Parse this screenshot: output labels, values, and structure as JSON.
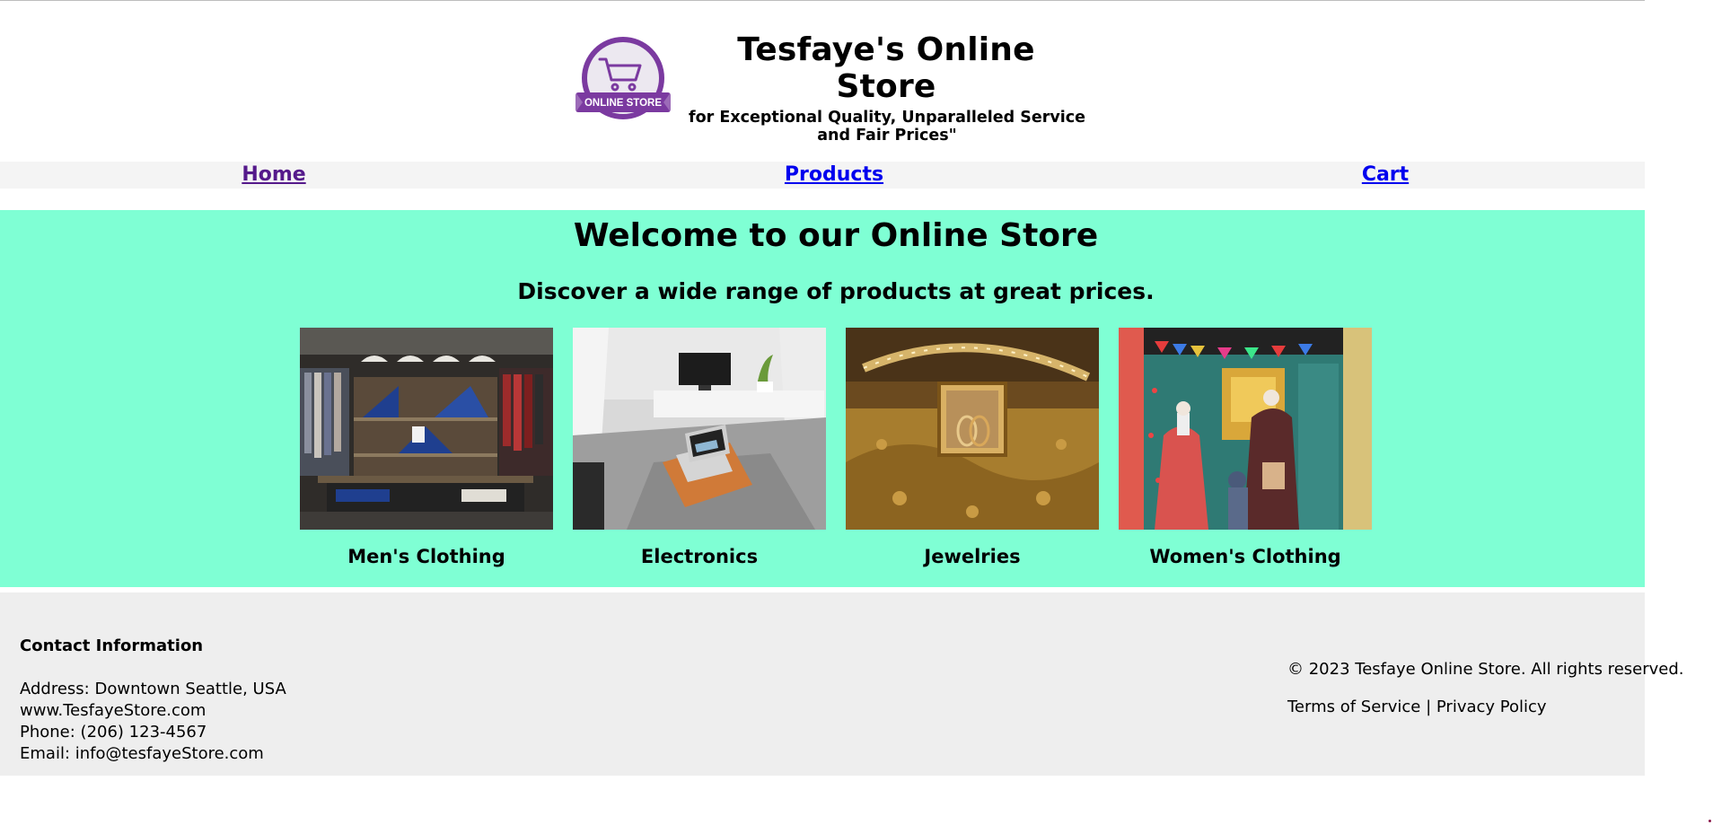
{
  "header": {
    "logo_text": "ONLINE STORE",
    "title": "Tesfaye's Online Store",
    "tagline": "for Exceptional Quality, Unparalleled Service and Fair Prices\""
  },
  "nav": {
    "home": "Home",
    "products": "Products",
    "cart": "Cart"
  },
  "hero": {
    "title": "Welcome to our Online Store",
    "subtitle": "Discover a wide range of products at great prices.",
    "categories": [
      {
        "label": "Men's Clothing"
      },
      {
        "label": "Electronics"
      },
      {
        "label": "Jewelries"
      },
      {
        "label": "Women's Clothing"
      }
    ]
  },
  "footer": {
    "contact_title": "Contact Information",
    "address": "Address: Downtown Seattle, USA",
    "website": "www.TesfayeStore.com",
    "phone": "Phone: (206) 123-4567",
    "email": "Email: info@tesfayeStore.com",
    "copyright": "© 2023 Tesfaye Online Store. All rights reserved.",
    "terms": "Terms of Service",
    "separator": "|",
    "privacy": "Privacy Policy"
  },
  "colors": {
    "hero_bg": "#7fffd4",
    "nav_bg": "#f4f4f4",
    "footer_bg": "#eeeeee",
    "logo_purple": "#7b3aa0",
    "link": "#0000ee",
    "visited_link": "#551a8b"
  }
}
